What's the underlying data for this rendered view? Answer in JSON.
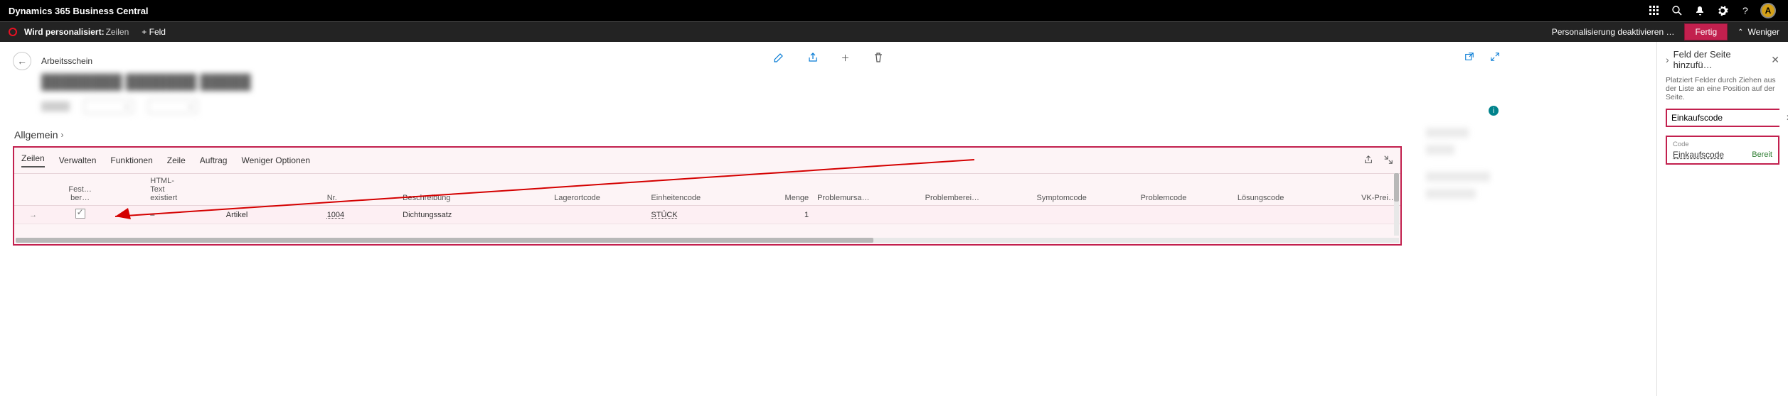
{
  "topbar": {
    "title": "Dynamics 365 Business Central",
    "avatar": "A"
  },
  "persbar": {
    "label": "Wird personalisiert:",
    "target": "Zeilen",
    "add_field": "+ Feld",
    "disable": "Personalisierung deaktivieren …",
    "done": "Fertig",
    "less": "Weniger"
  },
  "page": {
    "type": "Arbeitsschein",
    "title_placeholder": "████████  ███████  █████",
    "general_heading": "Allgemein"
  },
  "lines": {
    "tabs": {
      "zeilen": "Zeilen",
      "verwalten": "Verwalten",
      "funktionen": "Funktionen",
      "zeile": "Zeile",
      "auftrag": "Auftrag",
      "weniger": "Weniger Optionen"
    },
    "cols": {
      "fest": "Fest…\nber…",
      "html": "HTML-\nText\nexistiert",
      "nr": "Nr.",
      "beschreibung": "Beschreibung",
      "lagerort": "Lagerortcode",
      "einheit": "Einheitencode",
      "menge": "Menge",
      "problemursache": "Problemursa…",
      "problembereich": "Problemberei…",
      "symptom": "Symptomcode",
      "problem": "Problemcode",
      "loesung": "Lösungscode",
      "vkpreis": "VK-Prei…"
    },
    "rows": [
      {
        "type": "Artikel",
        "nr": "1004",
        "beschreibung": "Dichtungssatz",
        "einheit": "STÜCK",
        "menge": "1"
      }
    ]
  },
  "rightpane": {
    "title": "Feld der Seite hinzufü…",
    "desc": "Platziert Felder durch Ziehen aus der Liste an eine Position auf der Seite.",
    "search_value": "Einkaufscode",
    "field": {
      "label": "Code",
      "name": "Einkaufscode",
      "status": "Bereit"
    }
  }
}
